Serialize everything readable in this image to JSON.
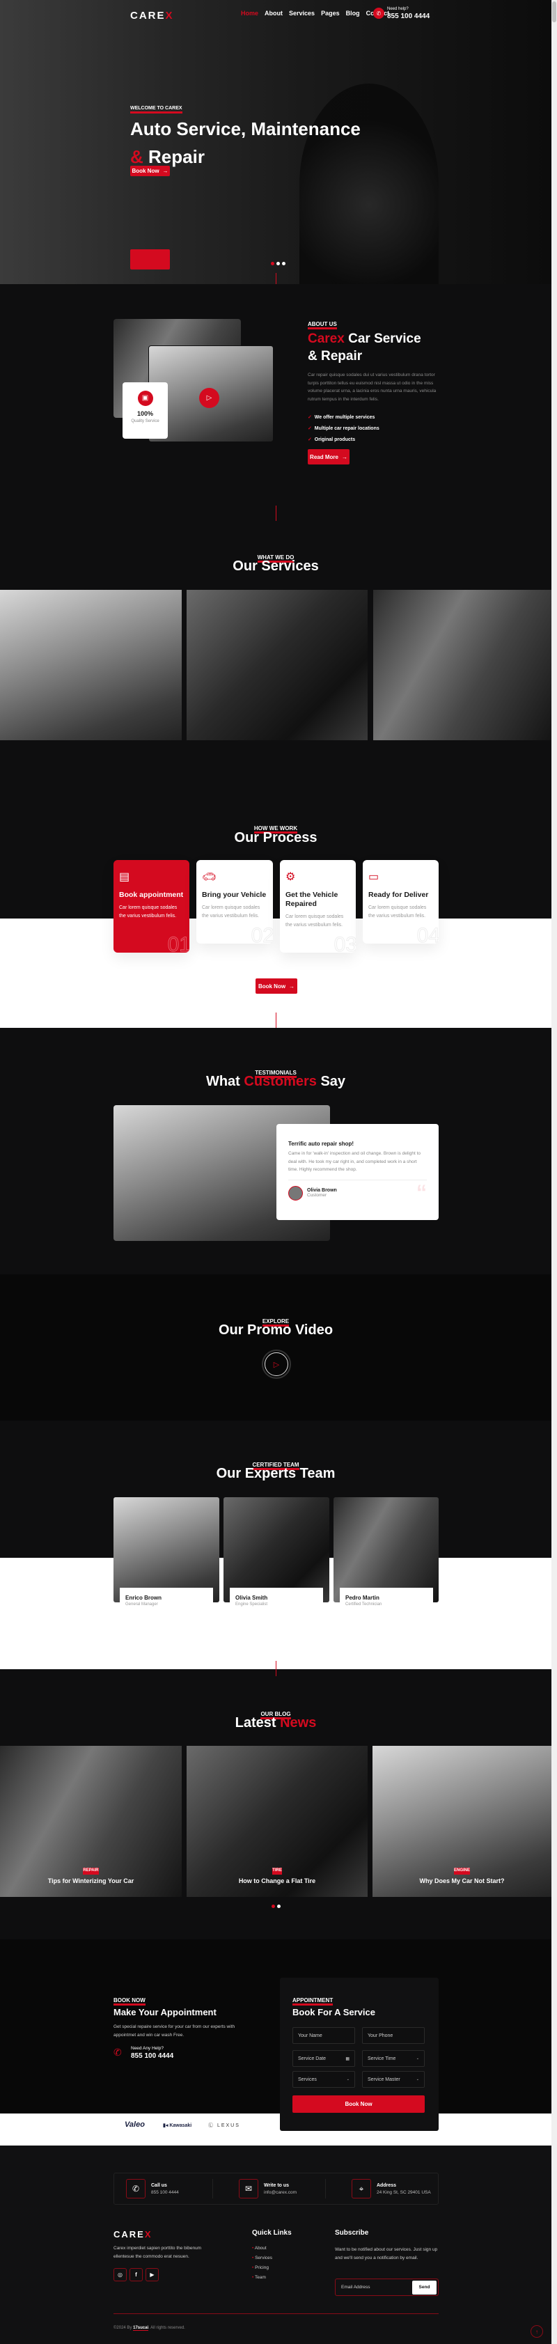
{
  "colors": {
    "accent": "#d40a1f",
    "dark": "#0e0e0f"
  },
  "header": {
    "logo": "CAREX",
    "nav": [
      "Home",
      "About",
      "Services",
      "Pages",
      "Blog",
      "Contact"
    ],
    "help_label": "Need help?",
    "phone": "855 100 4444"
  },
  "hero": {
    "tag": "WELCOME TO CAREX",
    "title_line1": "Auto Service, Maintenance",
    "title_amp": "&",
    "title_line2": "Repair",
    "button": "Book Now"
  },
  "about": {
    "tag": "ABOUT US",
    "title_brand": "Carex",
    "title_rest": "Car Service",
    "title_line2": "& Repair",
    "text": "Car repair quisque sodales dui ut varius vestibulum drana tortor turpis porttiton tellus eu euismod nisl massa ut odio in the miss volume placerat urna, a lacinia eros nunta urna mauris, vehicula rutrum tempus in the interdum felis.",
    "features": [
      "We offer multiple services",
      "Multiple car repair locations",
      "Original products"
    ],
    "button": "Read More",
    "badge_value": "100%",
    "badge_label": "Quality Service"
  },
  "services": {
    "tag": "WHAT WE DO",
    "title": "Our Services"
  },
  "process": {
    "tag": "HOW WE WORK",
    "title": "Our Process",
    "steps": [
      {
        "title": "Book appointment",
        "text": "Car lorem quisque sodales the varius vestibulum felis.",
        "num": "01"
      },
      {
        "title": "Bring your Vehicle",
        "text": "Car lorem quisque sodales the varius vestibulum felis.",
        "num": "02"
      },
      {
        "title": "Get the Vehicle Repaired",
        "text": "Car lorem quisque sodales the varius vestibulum felis.",
        "num": "03"
      },
      {
        "title": "Ready for Deliver",
        "text": "Car lorem quisque sodales the varius vestibulum felis.",
        "num": "04"
      }
    ],
    "button": "Book Now"
  },
  "testimonials": {
    "tag": "TESTIMONIALS",
    "title_a": "What",
    "title_b": "Customers",
    "title_c": "Say",
    "quote_title": "Terrific auto repair shop!",
    "quote": "Came in for 'walk-in' inspection and oil change. Brown is delight to deal with. He took my car right in, and completed work in a short time. Highly recommend the shop.",
    "author": "Olivia Brown",
    "role": "Customer"
  },
  "promo": {
    "tag": "EXPLORE",
    "title": "Our Promo Video"
  },
  "team": {
    "tag": "CERTIFIED TEAM",
    "title": "Our Experts Team",
    "members": [
      {
        "name": "Enrico Brown",
        "role": "General Manager"
      },
      {
        "name": "Olivia Smith",
        "role": "Engine Specialist"
      },
      {
        "name": "Pedro Martin",
        "role": "Certified Technician"
      }
    ]
  },
  "news": {
    "tag": "OUR BLOG",
    "title_a": "Latest",
    "title_b": "News",
    "posts": [
      {
        "category": "REPAIR",
        "title": "Tips for Winterizing Your Car"
      },
      {
        "category": "TIRE",
        "title": "How to Change a Flat Tire"
      },
      {
        "category": "ENGINE",
        "title": "Why Does My Car Not Start?"
      }
    ]
  },
  "appointment": {
    "tag": "BOOK NOW",
    "title": "Make Your Appointment",
    "text": "Get special repaire service for your car from our experts with appointmet and win car wash Free.",
    "help_label": "Need Any Help?",
    "phone": "855 100 4444",
    "form": {
      "tag": "APPOINTMENT",
      "title": "Book For A Service",
      "name": "Your Name",
      "phone": "Your Phone",
      "date": "Service Date",
      "time": "Service Time",
      "services": "Services",
      "master": "Service Master",
      "button": "Book Now"
    }
  },
  "brands": [
    "Valeo",
    "Kawasaki",
    "LEXUS"
  ],
  "footer": {
    "contacts": [
      {
        "label": "Call us",
        "value": "855 100 4444"
      },
      {
        "label": "Write to us",
        "value": "info@carex.com"
      },
      {
        "label": "Address",
        "value": "24 King St, SC 29401 USA"
      }
    ],
    "logo": "CAREX",
    "about": "Carex imperdiet sapien porttito the bibenum ellentesue the commodo erat nesuen.",
    "links_title": "Quick Links",
    "links": [
      "About",
      "Services",
      "Pricing",
      "Team"
    ],
    "subscribe_title": "Subscribe",
    "subscribe_text": "Want to be notified about our services. Just sign up and we'll send you a notification by email.",
    "email_placeholder": "Email Address",
    "send": "Send",
    "copyright_pre": "©2024 By",
    "copyright_brand": "17sucai",
    "copyright_post": ". All rights reserved."
  }
}
